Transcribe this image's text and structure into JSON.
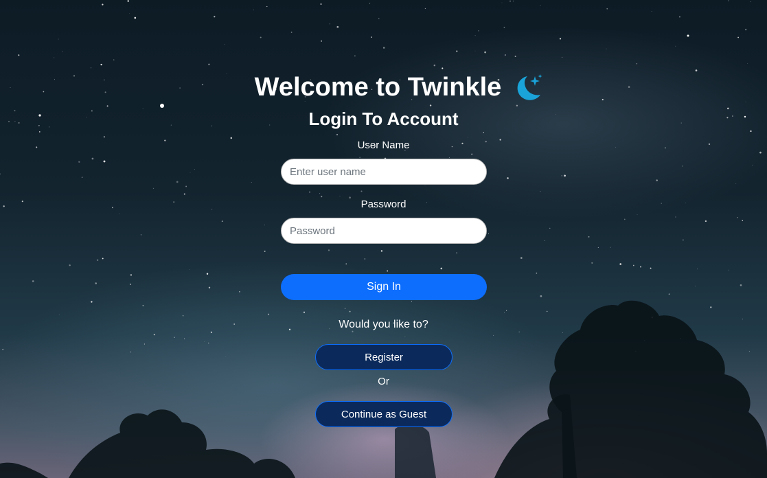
{
  "header": {
    "title": "Welcome to Twinkle",
    "icon": "moon-stars-icon",
    "icon_color": "#1aa3d8"
  },
  "form": {
    "heading": "Login To Account",
    "username_label": "User Name",
    "username_placeholder": "Enter user name",
    "username_value": "",
    "password_label": "Password",
    "password_placeholder": "Password",
    "password_value": "",
    "signin_label": "Sign In",
    "signin_color": "#0d6efd"
  },
  "alternatives": {
    "prompt": "Would you like to?",
    "register_label": "Register",
    "or_text": "Or",
    "guest_label": "Continue as Guest",
    "button_color": "#0b2a5b"
  }
}
